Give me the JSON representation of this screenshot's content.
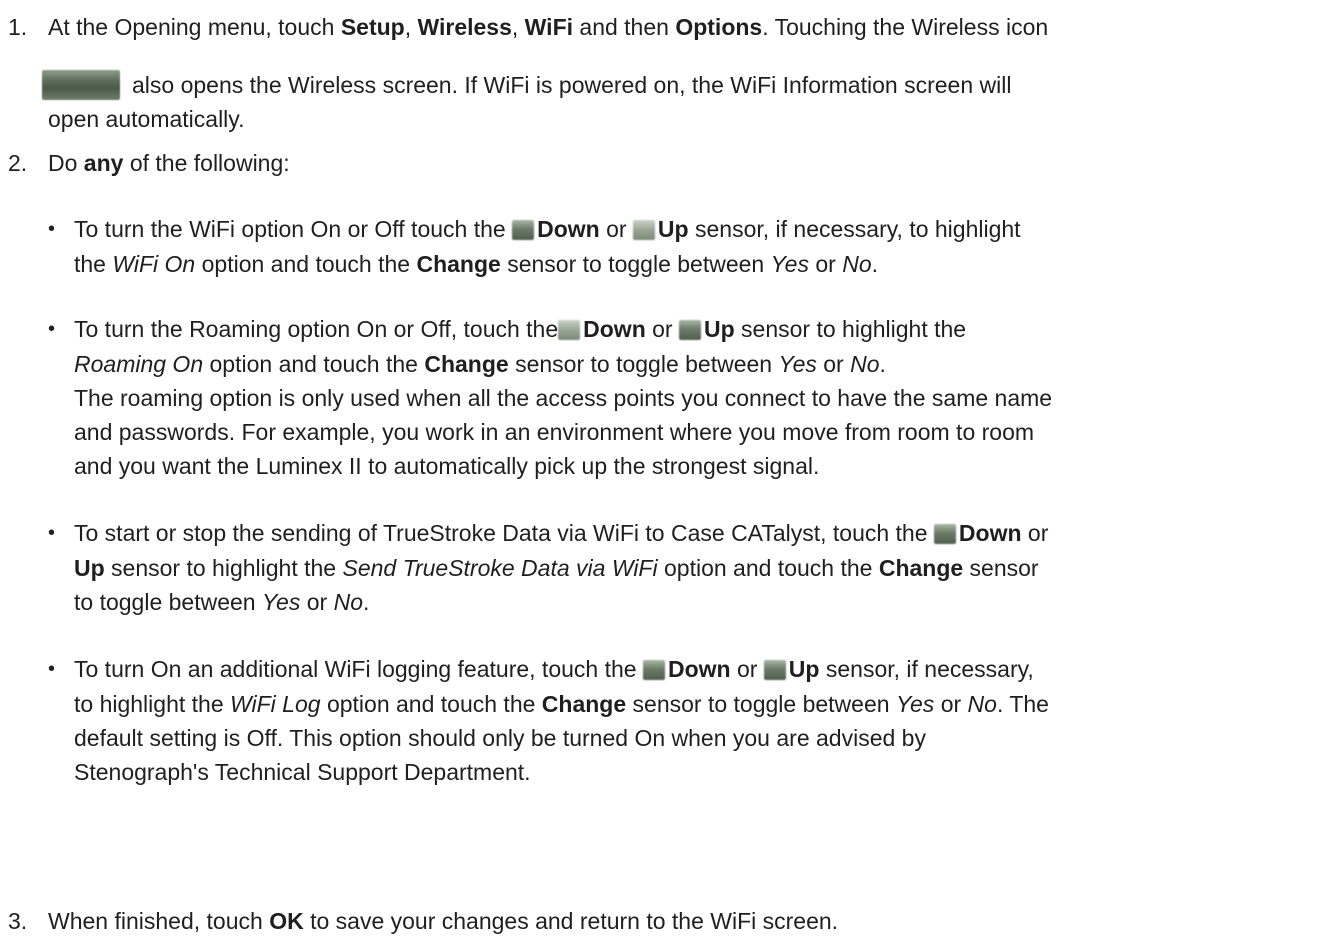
{
  "step1": {
    "number": "1.",
    "line1": {
      "t1": "At the Opening menu, touch ",
      "b1": "Setup",
      "t2": ", ",
      "b2": "Wireless",
      "t3": ", ",
      "b3": "WiFi",
      "t4": " and then ",
      "b4": "Options",
      "t5": ". Touching the Wireless icon"
    },
    "line2": "also opens the Wireless screen. If WiFi is powered on, the WiFi Information screen will",
    "line3": "open automatically."
  },
  "step2": {
    "number": "2.",
    "t1": "Do ",
    "b1": "any",
    "t2": " of the following:"
  },
  "bullet_char": "•",
  "bullet1": {
    "l1": {
      "t1": "To turn the WiFi option On or Off touch the ",
      "b1": "Down",
      "t2": " or ",
      "b2": "Up",
      "t3": " sensor, if necessary, to highlight"
    },
    "l2": {
      "t1": "the ",
      "i1": "WiFi On",
      "t2": " option and touch the ",
      "b1": "Change",
      "t3": " sensor to toggle between ",
      "i2": "Yes",
      "t4": " or ",
      "i3": "No",
      "t5": "."
    }
  },
  "bullet2": {
    "l1": {
      "t1": "To turn the Roaming option On or Off, touch the",
      "b1": "Down",
      "t2": " or ",
      "b2": "Up",
      "t3": " sensor to highlight the"
    },
    "l2": {
      "i1": "Roaming On",
      "t1": " option and touch the ",
      "b1": "Change",
      "t2": " sensor to toggle between ",
      "i2": "Yes",
      "t3": " or ",
      "i3": "No",
      "t4": "."
    },
    "l3": "The roaming option is only used when all the access points you connect to have the same name",
    "l4": "and passwords. For example, you work in an environment where you move from room to room",
    "l5": "and you want the Luminex II to automatically pick up the strongest signal."
  },
  "bullet3": {
    "l1": {
      "t1": "To start or stop the sending of TrueStroke Data via WiFi to Case CATalyst, touch the ",
      "b1": "Down",
      "t2": " or"
    },
    "l2": {
      "b1": "Up",
      "t1": " sensor to highlight the ",
      "i1": "Send TrueStroke Data via WiFi",
      "t2": " option and touch the ",
      "b2": "Change",
      "t3": " sensor"
    },
    "l3": {
      "t1": "to toggle between ",
      "i1": "Yes",
      "t2": " or ",
      "i2": "No",
      "t3": "."
    }
  },
  "bullet4": {
    "l1": {
      "t1": "To turn On an additional WiFi logging feature, touch the ",
      "b1": "Down",
      "t2": " or ",
      "b2": "Up",
      "t3": " sensor, if necessary,"
    },
    "l2": {
      "t1": "to highlight the ",
      "i1": "WiFi Log",
      "t2": " option and touch the ",
      "b1": "Change",
      "t3": " sensor to toggle between ",
      "i2": "Yes",
      "t4": " or ",
      "i3": "No",
      "t5": ". The"
    },
    "l3": "default setting is Off. This option should only be turned On when you are advised by",
    "l4": "Stenograph's Technical Support Department."
  },
  "step3": {
    "number": "3.",
    "t1": "When finished, touch ",
    "b1": "OK",
    "t2": " to save your changes and return to the WiFi screen."
  },
  "icons": {
    "wireless": "wireless-icon",
    "down_sensor": "down-sensor-icon",
    "up_sensor": "up-sensor-icon"
  }
}
